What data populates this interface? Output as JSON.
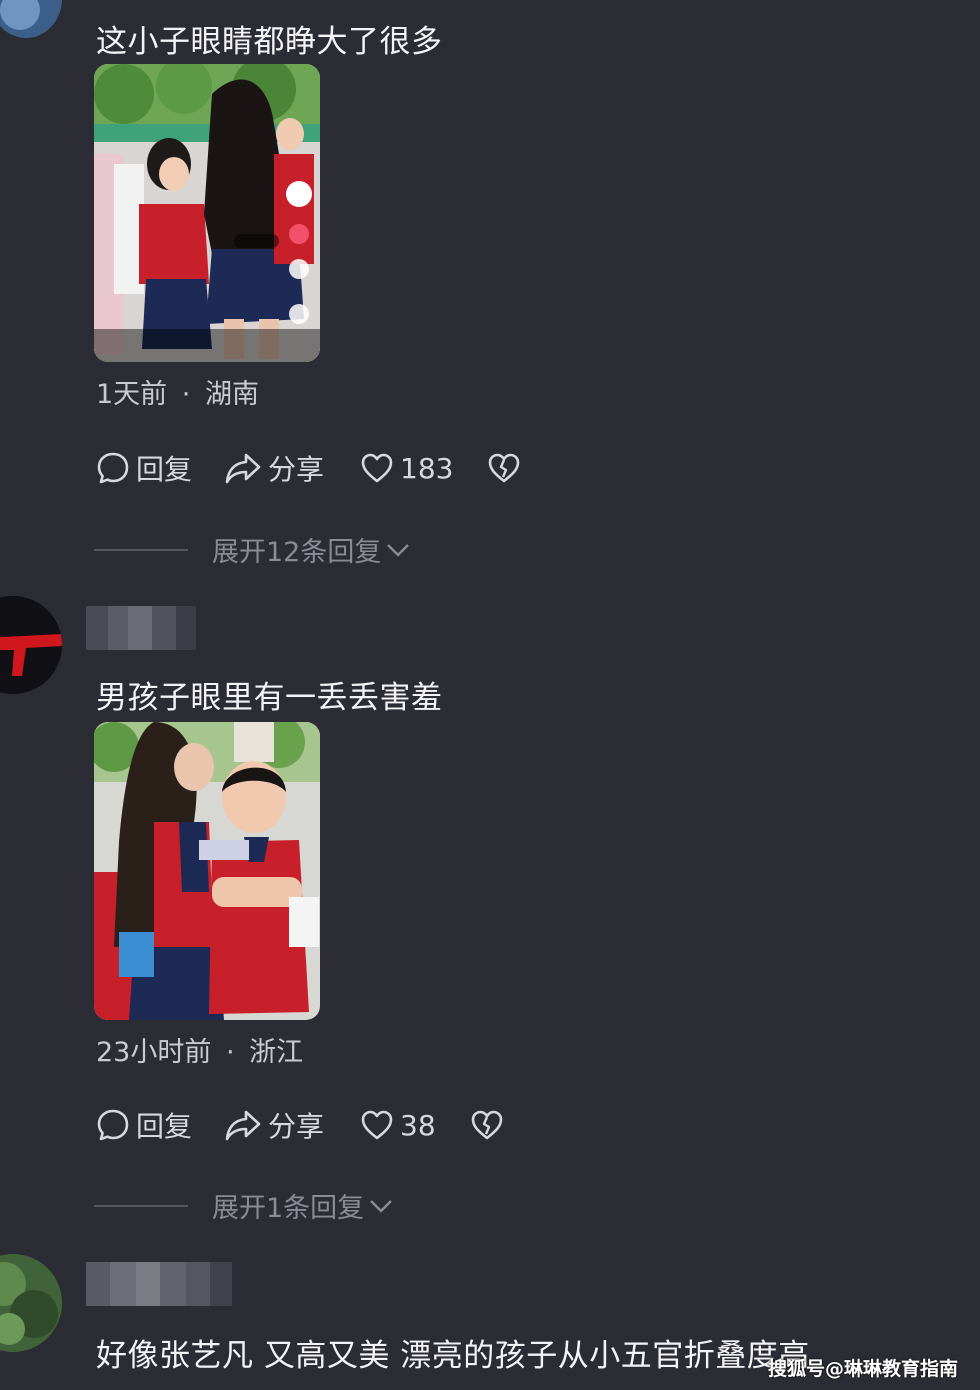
{
  "comments": [
    {
      "text": "这小子眼睛都睁大了很多",
      "time": "1天前",
      "sep": "·",
      "location": "湖南",
      "reply_label": "回复",
      "share_label": "分享",
      "like_count": "183",
      "expand_label": "展开12条回复"
    },
    {
      "text": "男孩子眼里有一丢丢害羞",
      "time": "23小时前",
      "sep": "·",
      "location": "浙江",
      "reply_label": "回复",
      "share_label": "分享",
      "like_count": "38",
      "expand_label": "展开1条回复"
    },
    {
      "text": "好像张艺凡 又高又美 漂亮的孩子从小五官折叠度高"
    }
  ],
  "watermark": "搜狐号@琳琳教育指南",
  "colors": {
    "background": "#2b2c34",
    "text": "#f4f4f6",
    "muted": "#8a8b95",
    "uniform_red": "#c8202a",
    "uniform_navy": "#1d2a55"
  }
}
